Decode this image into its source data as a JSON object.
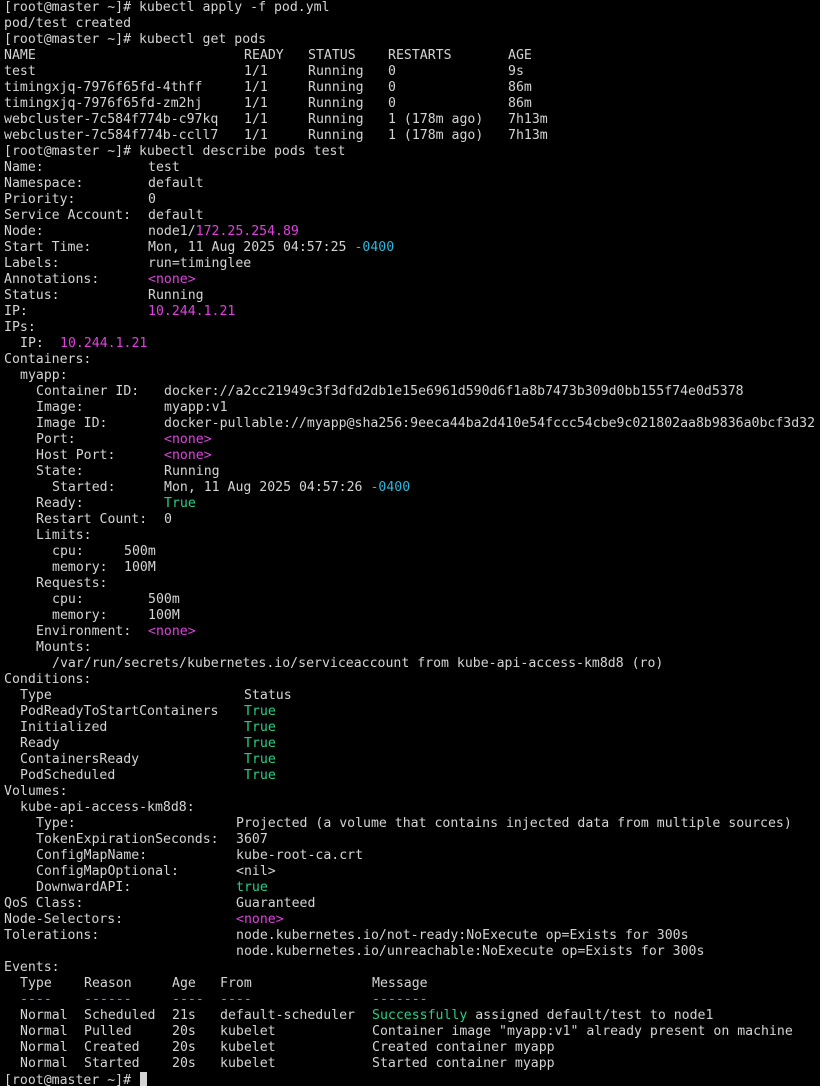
{
  "colors": {
    "background": "#000000",
    "text": "#d4d4d4",
    "magenta": "#e040e0",
    "cyan": "#29b8db",
    "green": "#23d18b"
  },
  "prompt": "[root@master ~]#",
  "commands": {
    "apply": " kubectl apply -f pod.yml",
    "get": " kubectl get pods",
    "describe": " kubectl describe pods test"
  },
  "apply_output": "pod/test created",
  "get_pods": {
    "headers": [
      "NAME",
      "READY",
      "STATUS",
      "RESTARTS",
      "AGE"
    ],
    "rows": [
      [
        "test",
        "1/1",
        "Running",
        "0",
        "9s"
      ],
      [
        "timingxjq-7976f65fd-4thff",
        "1/1",
        "Running",
        "0",
        "86m"
      ],
      [
        "timingxjq-7976f65fd-zm2hj",
        "1/1",
        "Running",
        "0",
        "86m"
      ],
      [
        "webcluster-7c584f774b-c97kq",
        "1/1",
        "Running",
        "1 (178m ago)",
        "7h13m"
      ],
      [
        "webcluster-7c584f774b-ccll7",
        "1/1",
        "Running",
        "1 (178m ago)",
        "7h13m"
      ]
    ]
  },
  "describe": {
    "name_label": "Name:",
    "name": "test",
    "namespace_label": "Namespace:",
    "namespace": "default",
    "priority_label": "Priority:",
    "priority": "0",
    "sa_label": "Service Account:",
    "sa": "default",
    "node_label": "Node:",
    "node_name": "node1/",
    "node_ip": "172.25.254.89",
    "start_label": "Start Time:",
    "start": "Mon, 11 Aug 2025 04:57:25 ",
    "start_tz": "-0400",
    "labels_label": "Labels:",
    "labels": "run=timinglee",
    "annotations_label": "Annotations:",
    "annotations": "<none>",
    "status_label": "Status:",
    "status": "Running",
    "ip_label": "IP:",
    "ip": "10.244.1.21",
    "ips_label": "IPs:",
    "ips_ip_label": "IP:",
    "ips_ip": "10.244.1.21",
    "containers_label": "Containers:",
    "container_name": "myapp:",
    "cid_label": "Container ID:",
    "cid": "docker://a2cc21949c3f3dfd2db1e15e6961d590d6f1a8b7473b309d0bb155f74e0d5378",
    "image_label": "Image:",
    "image": "myapp:v1",
    "imageid_label": "Image ID:",
    "imageid": "docker-pullable://myapp@sha256:9eeca44ba2d410e54fccc54cbe9c021802aa8b9836a0bcf3d32",
    "port_label": "Port:",
    "port": "<none>",
    "hostport_label": "Host Port:",
    "hostport": "<none>",
    "state_label": "State:",
    "state": "Running",
    "started_label": "Started:",
    "started": "Mon, 11 Aug 2025 04:57:26 ",
    "started_tz": "-0400",
    "ready_label": "Ready:",
    "ready": "True",
    "restart_label": "Restart Count:",
    "restart": "0",
    "limits_label": "Limits:",
    "lim_cpu_label": "cpu:",
    "lim_cpu": "500m",
    "lim_mem_label": "memory:",
    "lim_mem": "100M",
    "requests_label": "Requests:",
    "req_cpu_label": "cpu:",
    "req_cpu": "500m",
    "req_mem_label": "memory:",
    "req_mem": "100M",
    "env_label": "Environment:",
    "env": "<none>",
    "mounts_label": "Mounts:",
    "mount": "/var/run/secrets/kubernetes.io/serviceaccount from kube-api-access-km8d8 (ro)"
  },
  "conditions": {
    "label": "Conditions:",
    "headers": [
      "Type",
      "Status"
    ],
    "rows": [
      [
        "PodReadyToStartContainers",
        "True"
      ],
      [
        "Initialized",
        "True"
      ],
      [
        "Ready",
        "True"
      ],
      [
        "ContainersReady",
        "True"
      ],
      [
        "PodScheduled",
        "True"
      ]
    ]
  },
  "volumes": {
    "label": "Volumes:",
    "name": "kube-api-access-km8d8:",
    "type_label": "Type:",
    "type": "Projected (a volume that contains injected data from multiple sources)",
    "token_label": "TokenExpirationSeconds:",
    "token": "3607",
    "cmname_label": "ConfigMapName:",
    "cmname": "kube-root-ca.crt",
    "cmopt_label": "ConfigMapOptional:",
    "cmopt": "<nil>",
    "downward_label": "DownwardAPI:",
    "downward": "true"
  },
  "qos_label": "QoS Class:",
  "qos": "Guaranteed",
  "selectors_label": "Node-Selectors:",
  "selectors": "<none>",
  "tolerations_label": "Tolerations:",
  "tolerations": [
    "node.kubernetes.io/not-ready:NoExecute op=Exists for 300s",
    "node.kubernetes.io/unreachable:NoExecute op=Exists for 300s"
  ],
  "events": {
    "label": "Events:",
    "headers": [
      "Type",
      "Reason",
      "Age",
      "From",
      "Message"
    ],
    "underlines": [
      "----",
      "------",
      "----",
      "----",
      "-------"
    ],
    "rows": [
      {
        "type": "Normal",
        "reason": "Scheduled",
        "age": "21s",
        "from": "default-scheduler",
        "msg_hl": "Successfully",
        "msg": " assigned default/test to node1"
      },
      {
        "type": "Normal",
        "reason": "Pulled",
        "age": "20s",
        "from": "kubelet",
        "msg_hl": "",
        "msg": "Container image \"myapp:v1\" already present on machine"
      },
      {
        "type": "Normal",
        "reason": "Created",
        "age": "20s",
        "from": "kubelet",
        "msg_hl": "",
        "msg": "Created container myapp"
      },
      {
        "type": "Normal",
        "reason": "Started",
        "age": "20s",
        "from": "kubelet",
        "msg_hl": "",
        "msg": "Started container myapp"
      }
    ]
  }
}
